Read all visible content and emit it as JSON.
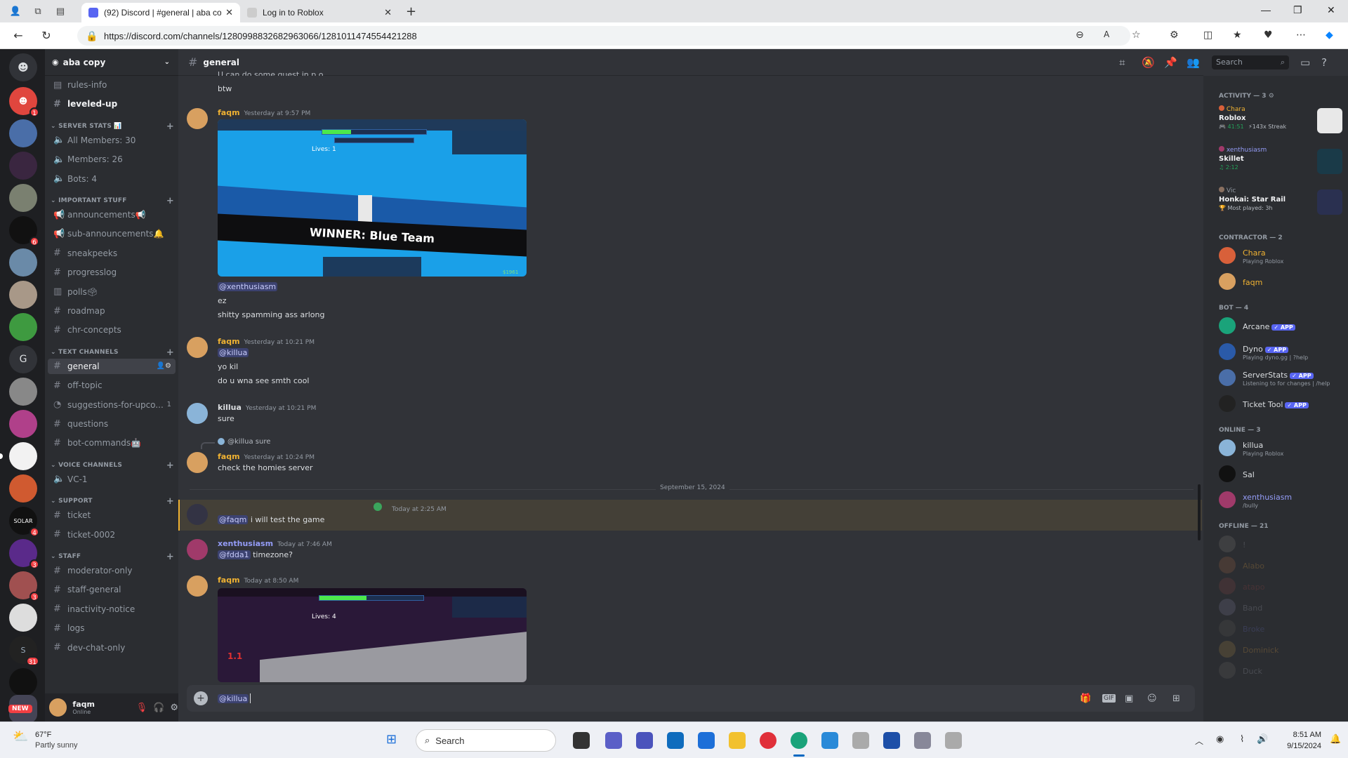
{
  "browser": {
    "tabs": [
      {
        "title": "(92) Discord | #general | aba cop",
        "active": true
      },
      {
        "title": "Log in to Roblox",
        "active": false
      }
    ],
    "url": "https://discord.com/channels/1280998832682963066/1281011474554421288"
  },
  "guild_rail": {
    "badges": [
      "1",
      "6",
      "4",
      "3",
      "3",
      "31"
    ],
    "letter_guild": "G",
    "new_label": "NEW"
  },
  "server": {
    "name": "aba copy",
    "top_channels": [
      "rules-info",
      "leveled-up"
    ],
    "categories": [
      {
        "name": "SERVER STATS 📊",
        "channels": [
          "All Members: 30",
          "Members: 26",
          "Bots: 4"
        ]
      },
      {
        "name": "IMPORTANT STUFF",
        "channels": [
          "announcements📢",
          "sub-announcements🔔",
          "sneakpeeks",
          "progresslog",
          "polls🗳",
          "roadmap",
          "chr-concepts"
        ]
      },
      {
        "name": "TEXT CHANNELS",
        "channels": [
          "general",
          "off-topic",
          "suggestions-for-upco...",
          "questions",
          "bot-commands🤖"
        ]
      },
      {
        "name": "VOICE CHANNELS",
        "channels": [
          "VC-1"
        ]
      },
      {
        "name": "SUPPORT",
        "channels": [
          "ticket",
          "ticket-0002"
        ]
      },
      {
        "name": "STAFF",
        "channels": [
          "moderator-only",
          "staff-general",
          "inactivity-notice",
          "logs",
          "dev-chat-only"
        ]
      }
    ],
    "suggestions_count": "1"
  },
  "user": {
    "name": "faqm",
    "status": "Online"
  },
  "chat": {
    "channel": "general",
    "search_placeholder": "Search",
    "top_fragment": "U can do some quest in p.o",
    "top_btw": "btw",
    "date_divider": "September 15, 2024",
    "game1": {
      "lives": "Lives: 1",
      "winner": "WINNER: Blue Team",
      "money": "$1961"
    },
    "game2": {
      "lives": "Lives: 4",
      "counter": "1.1"
    },
    "messages": [
      {
        "author": "faqm",
        "time": "Yesterday at 9:57 PM",
        "lines": [
          "@xenthusiasm",
          "ez",
          "shitty spamming ass arlong"
        ]
      },
      {
        "author": "faqm",
        "time": "Yesterday at 10:21 PM",
        "lines": [
          "@killua",
          "yo kil",
          "do u wna see smth cool"
        ]
      },
      {
        "author": "killua",
        "time": "Yesterday at 10:21 PM",
        "lines": [
          "sure"
        ]
      },
      {
        "author": "faqm",
        "time": "Yesterday at 10:24 PM",
        "reply": "@killua sure",
        "lines": [
          "check the homies server"
        ]
      },
      {
        "author": "",
        "time": "Today at 2:25 AM",
        "mention": "@faqm",
        "lines": [
          "i will test the game"
        ]
      },
      {
        "author": "xenthusiasm",
        "time": "Today at 7:46 AM",
        "mention": "@fdda1",
        "lines": [
          "timezone?"
        ]
      },
      {
        "author": "faqm",
        "time": "Today at 8:50 AM",
        "lines": []
      }
    ],
    "composer_value": "@killua"
  },
  "members": {
    "activity_title": "ACTIVITY — 3",
    "activities": [
      {
        "user": "Chara",
        "game": "Roblox",
        "time": "41:51",
        "extra": "143x Streak"
      },
      {
        "user": "xenthusiasm",
        "game": "Skillet",
        "time": "2:12"
      },
      {
        "user": "Vic",
        "game": "Honkai: Star Rail",
        "extra": "Most played: 3h"
      }
    ],
    "groups": [
      {
        "title": "CONTRACTOR — 2",
        "members": [
          {
            "name": "Chara",
            "status": "Playing Roblox",
            "color": "#f0b232"
          },
          {
            "name": "faqm",
            "status": "",
            "color": "#f0b232"
          }
        ]
      },
      {
        "title": "BOT — 4",
        "members": [
          {
            "name": "Arcane",
            "status": "",
            "color": "#dbdee1",
            "tag": "✓ APP"
          },
          {
            "name": "Dyno",
            "status": "Playing dyno.gg | ?help",
            "color": "#dbdee1",
            "tag": "✓ APP"
          },
          {
            "name": "ServerStats",
            "status": "Listening to for changes | /help",
            "color": "#dbdee1",
            "tag": "✓ APP"
          },
          {
            "name": "Ticket Tool",
            "status": "",
            "color": "#dbdee1",
            "tag": "✓ APP"
          }
        ]
      },
      {
        "title": "ONLINE — 3",
        "members": [
          {
            "name": "killua",
            "status": "Playing Roblox",
            "color": "#dbdee1"
          },
          {
            "name": "Sal",
            "status": "",
            "color": "#dbdee1"
          },
          {
            "name": "xenthusiasm",
            "status": "/bully",
            "color": "#949cf7"
          }
        ]
      },
      {
        "title": "OFFLINE — 21",
        "members": [
          {
            "name": "!",
            "status": "",
            "color": "#6d6f78"
          },
          {
            "name": "Alabo",
            "status": "",
            "color": "#8a6a3a"
          },
          {
            "name": "atapo",
            "status": "",
            "color": "#6b3a3a"
          },
          {
            "name": "Band",
            "status": "",
            "color": "#6d6f78"
          },
          {
            "name": "Broke",
            "status": "",
            "color": "#4a5080"
          },
          {
            "name": "Dominick",
            "status": "",
            "color": "#8a6a3a"
          },
          {
            "name": "Duck",
            "status": "",
            "color": "#6d6f78"
          }
        ]
      }
    ]
  },
  "taskbar": {
    "weather_temp": "67°F",
    "weather_desc": "Partly sunny",
    "search": "Search",
    "time": "8:51 AM",
    "date": "9/15/2024"
  }
}
